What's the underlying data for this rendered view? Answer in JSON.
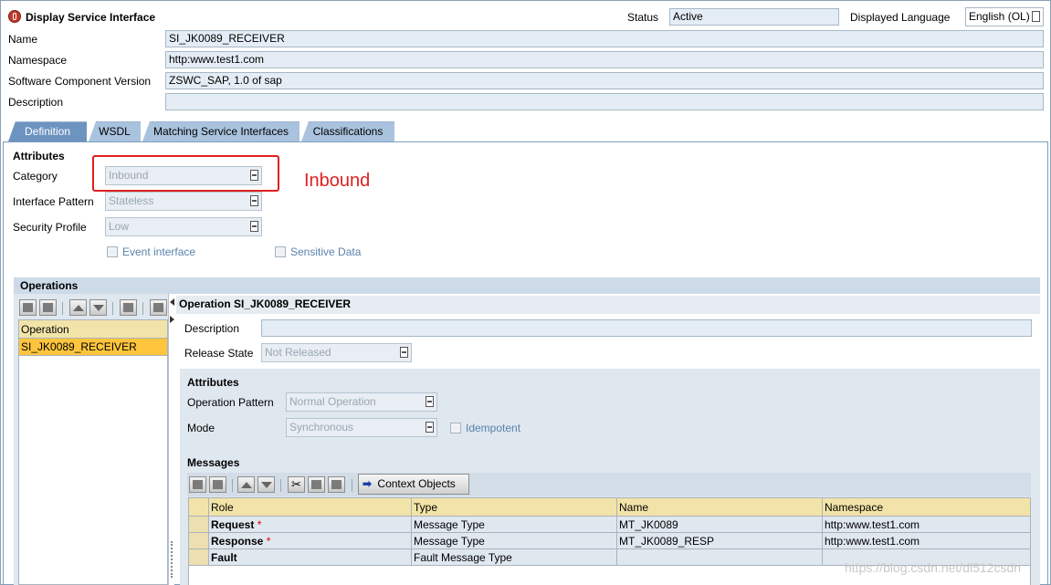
{
  "header": {
    "title": "Display Service Interface",
    "status_label": "Status",
    "status_value": "Active",
    "language_label": "Displayed Language",
    "language_value": "English (OL)"
  },
  "fields": {
    "name_label": "Name",
    "name_value": "SI_JK0089_RECEIVER",
    "namespace_label": "Namespace",
    "namespace_value": "http:www.test1.com",
    "swcv_label": "Software Component Version",
    "swcv_value": "ZSWC_SAP, 1.0 of sap",
    "description_label": "Description",
    "description_value": ""
  },
  "tabs": [
    {
      "label": "Definition",
      "active": true
    },
    {
      "label": "WSDL",
      "active": false
    },
    {
      "label": "Matching Service Interfaces",
      "active": false
    },
    {
      "label": "Classifications",
      "active": false
    }
  ],
  "attributes": {
    "heading": "Attributes",
    "category_label": "Category",
    "category_value": "Inbound",
    "pattern_label": "Interface Pattern",
    "pattern_value": "Stateless",
    "security_label": "Security Profile",
    "security_value": "Low",
    "event_label": "Event interface",
    "sensitive_label": "Sensitive Data",
    "annotation_text": "Inbound",
    "annotation_color": "#e02020"
  },
  "operations": {
    "heading": "Operations",
    "list_header": "Operation",
    "items": [
      "SI_JK0089_RECEIVER"
    ],
    "detail_title": "Operation SI_JK0089_RECEIVER",
    "description_label": "Description",
    "release_label": "Release State",
    "release_value": "Not Released",
    "attr_heading": "Attributes",
    "op_pattern_label": "Operation Pattern",
    "op_pattern_value": "Normal Operation",
    "mode_label": "Mode",
    "mode_value": "Synchronous",
    "idempotent_label": "Idempotent"
  },
  "messages": {
    "heading": "Messages",
    "context_button": "Context Objects",
    "columns": [
      "Role",
      "Type",
      "Name",
      "Namespace"
    ],
    "rows": [
      {
        "role": "Request",
        "required": true,
        "type": "Message Type",
        "name": "MT_JK0089",
        "namespace": "http:www.test1.com"
      },
      {
        "role": "Response",
        "required": true,
        "type": "Message Type",
        "name": "MT_JK0089_RESP",
        "namespace": "http:www.test1.com"
      },
      {
        "role": "Fault",
        "required": false,
        "type": "Fault Message Type",
        "name": "",
        "namespace": ""
      }
    ],
    "required_mark": "*"
  },
  "watermark": "https://blog.csdn.net/dl512csdn",
  "colors": {
    "tab_active": "#6d93c0",
    "tab_inactive": "#a9c3de",
    "selection": "#ffc53d",
    "section_header": "#cddbe8"
  }
}
